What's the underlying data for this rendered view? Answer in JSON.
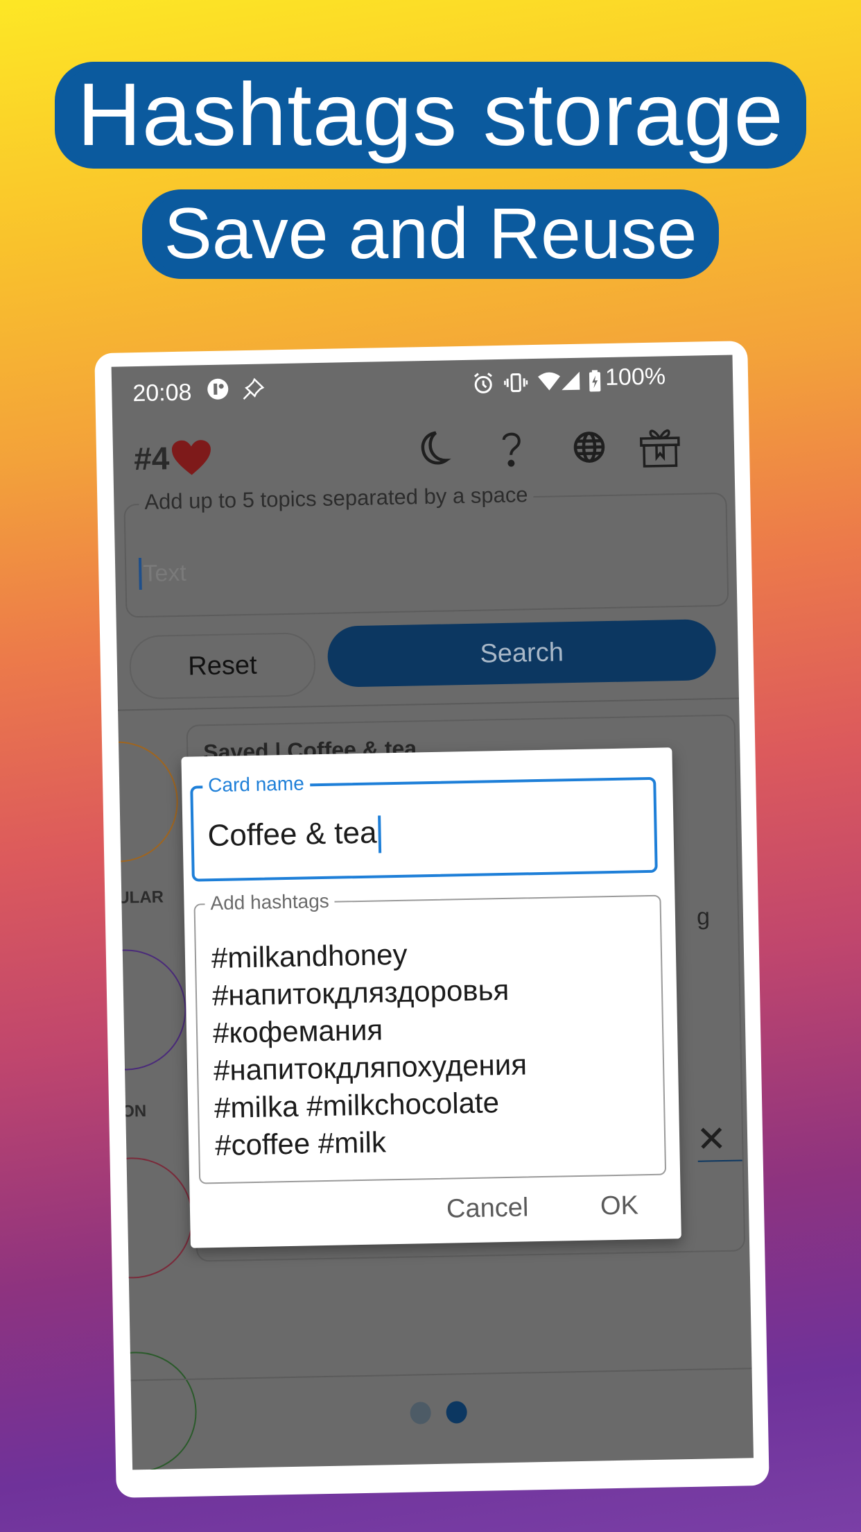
{
  "headline": {
    "line1": "Hashtags storage",
    "line2": "Save and Reuse",
    "color": "#0b5a9e"
  },
  "status_bar": {
    "time": "20:08",
    "left_icons": [
      "app-notification-icon",
      "pin-icon"
    ],
    "right_icons": [
      "alarm-icon",
      "vibrate-icon",
      "wifi-icon",
      "signal-icon",
      "battery-charging-icon"
    ],
    "battery": "100%"
  },
  "toolbar": {
    "brand": "#4",
    "brand_icon": "heart-icon",
    "icons": [
      "moon-icon",
      "help-icon",
      "globe-icon",
      "gift-icon"
    ]
  },
  "search": {
    "label": "Add up to 5 topics separated by a space",
    "placeholder": "Text",
    "value": "",
    "reset_label": "Reset",
    "search_label": "Search"
  },
  "side_tabs": [
    {
      "label": "ULAR",
      "color": "#a0651e"
    },
    {
      "label": "ON",
      "color": "#4a2a7a"
    },
    {
      "label": "",
      "color": "#7a2a3a"
    },
    {
      "label": "",
      "color": "#2a5a2a"
    }
  ],
  "saved_card": {
    "title": "Saved | Coffee & tea",
    "partial_text": "g",
    "close_icon": "close-icon"
  },
  "dialog": {
    "card_name_label": "Card name",
    "card_name_value": "Coffee & tea",
    "hashtags_label": "Add hashtags",
    "hashtags_value": "#milkandhoney\n#напитокдляздоровья\n#кофемания\n#напитокдляпохудения\n#milka #milkchocolate\n#coffee #milk",
    "cancel_label": "Cancel",
    "ok_label": "OK",
    "accent": "#1e7fd8"
  },
  "pager": {
    "pages": 2,
    "active": 2
  }
}
